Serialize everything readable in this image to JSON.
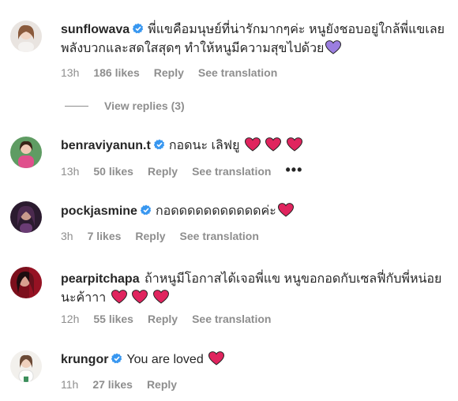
{
  "comments": [
    {
      "username": "sunflowava",
      "verified": true,
      "text": "พี่แขคือมนุษย์ที่น่ารักมากๆค่ะ หนูยังชอบอยู่ใกล้พี่แขเลย พลังบวกและสดใสสุดๆ ทำให้หนูมีความสุขไปด้วย",
      "emoji": "purple-heart",
      "time": "13h",
      "likes": "186 likes",
      "reply": "Reply",
      "translation": "See translation",
      "view_replies": "View replies (3)"
    },
    {
      "username": "benraviyanun.t",
      "verified": true,
      "text": "กอดนะ เลิฟยู",
      "emoji": "red-heart x3",
      "time": "13h",
      "likes": "50 likes",
      "reply": "Reply",
      "translation": "See translation",
      "more": "•••"
    },
    {
      "username": "pockjasmine",
      "verified": true,
      "text": "กอดดดดดดดดดดดค่ะ",
      "emoji": "red-heart",
      "time": "3h",
      "likes": "7 likes",
      "reply": "Reply",
      "translation": "See translation"
    },
    {
      "username": "pearpitchapa",
      "verified": false,
      "text": "ถ้าหนูมีโอกาสได้เจอพี่แข หนูขอกอดกับเซลฟี่กับพี่หน่อยนะค้าาา",
      "emoji": "red-heart x3",
      "time": "12h",
      "likes": "55 likes",
      "reply": "Reply",
      "translation": "See translation"
    },
    {
      "username": "krungor",
      "verified": true,
      "text": "You are loved",
      "emoji": "red-heart",
      "time": "11h",
      "likes": "27 likes",
      "reply": "Reply"
    }
  ],
  "colors": {
    "text": "#262626",
    "meta": "#8e8e8e",
    "verified": "#3897f0",
    "heart_red": "#e0245e",
    "heart_purple": "#9b7ee0"
  }
}
